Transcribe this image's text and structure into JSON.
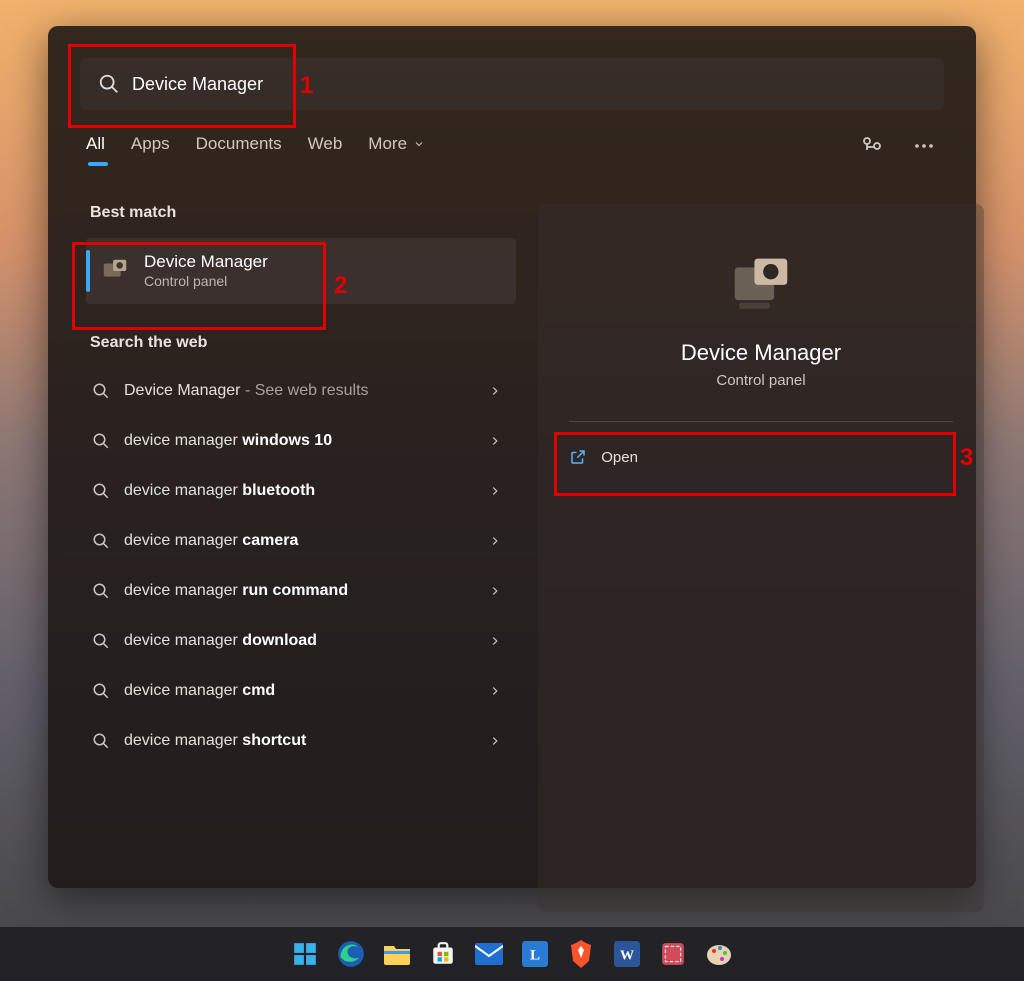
{
  "search": {
    "value": "Device Manager"
  },
  "tabs": {
    "items": [
      {
        "label": "All",
        "active": true
      },
      {
        "label": "Apps",
        "active": false
      },
      {
        "label": "Documents",
        "active": false
      },
      {
        "label": "Web",
        "active": false
      },
      {
        "label": "More",
        "active": false,
        "dropdown": true
      }
    ]
  },
  "sections": {
    "best_match_label": "Best match",
    "search_web_label": "Search the web"
  },
  "best_match": {
    "title": "Device Manager",
    "subtitle": "Control panel"
  },
  "web_results": [
    {
      "prefix": "Device Manager",
      "suffix": "",
      "dim_suffix": " - See web results"
    },
    {
      "prefix": "device manager ",
      "suffix": "windows 10",
      "dim_suffix": ""
    },
    {
      "prefix": "device manager ",
      "suffix": "bluetooth",
      "dim_suffix": ""
    },
    {
      "prefix": "device manager ",
      "suffix": "camera",
      "dim_suffix": ""
    },
    {
      "prefix": "device manager ",
      "suffix": "run command",
      "dim_suffix": ""
    },
    {
      "prefix": "device manager ",
      "suffix": "download",
      "dim_suffix": ""
    },
    {
      "prefix": "device manager ",
      "suffix": "cmd",
      "dim_suffix": ""
    },
    {
      "prefix": "device manager ",
      "suffix": "shortcut",
      "dim_suffix": ""
    }
  ],
  "preview": {
    "title": "Device Manager",
    "subtitle": "Control panel",
    "open_label": "Open"
  },
  "annotations": {
    "n1": "1",
    "n2": "2",
    "n3": "3"
  },
  "taskbar": {
    "items": [
      {
        "name": "start-icon"
      },
      {
        "name": "edge-icon"
      },
      {
        "name": "file-explorer-icon"
      },
      {
        "name": "microsoft-store-icon"
      },
      {
        "name": "mail-icon"
      },
      {
        "name": "l-app-icon"
      },
      {
        "name": "brave-icon"
      },
      {
        "name": "word-icon"
      },
      {
        "name": "snip-icon"
      },
      {
        "name": "paint-icon"
      }
    ]
  }
}
